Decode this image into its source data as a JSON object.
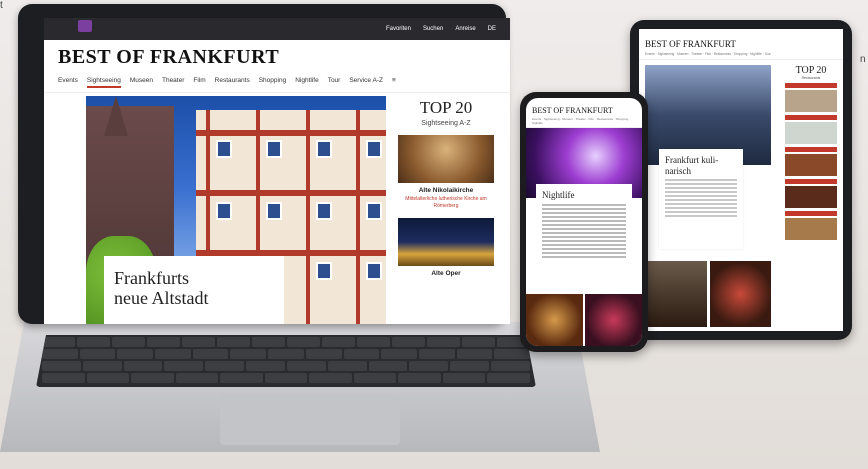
{
  "corner": {
    "top_left_glyph": "t",
    "left_glyph": "n"
  },
  "laptop": {
    "topbar": [
      "Favoriten",
      "Suchen",
      "Anreise",
      "DE"
    ],
    "brand": "BEST OF FRANKFURT",
    "nav": [
      "Events",
      "Sightseeing",
      "Museen",
      "Theater",
      "Film",
      "Restaurants",
      "Shopping",
      "Nightlife",
      "Tour",
      "Service A-Z",
      "≡"
    ],
    "active_nav": "Sightseeing",
    "hero_title_line1": "Frankfurts",
    "hero_title_line2": "neue Altstadt",
    "side": {
      "title": "TOP 20",
      "subtitle": "Sightseeing A-Z",
      "item1_title": "Alte Nikolaikirche",
      "item1_desc": "Mittelalterliche lutherische Kirche am Römerberg",
      "item2_title": "Alte Oper"
    }
  },
  "phone": {
    "brand": "BEST OF FRANKFURT",
    "card_title": "Nightlife"
  },
  "tablet": {
    "brand": "BEST OF FRANKFURT",
    "card_title": "Frankfurt kuli-narisch",
    "side_title": "TOP 20",
    "side_sub": "Restaurants"
  },
  "colors": {
    "accent": "#c0392b",
    "device_frame": "#1d1e21"
  }
}
